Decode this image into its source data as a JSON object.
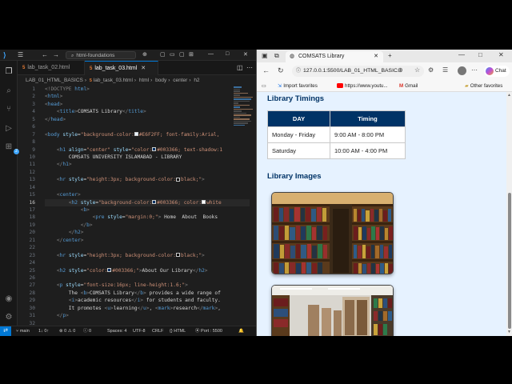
{
  "vscode": {
    "search": "html-foundations",
    "tabs": [
      {
        "label": "lab_task_02.html",
        "active": false
      },
      {
        "label": "lab_task_03.html",
        "active": true
      }
    ],
    "breadcrumb": [
      "LAB_01_HTML_BASICS",
      "lab_task_03.html",
      "html",
      "body",
      "center",
      "h2"
    ],
    "current_line": 16,
    "lines": [
      [
        {
          "c": "p",
          "t": "<!DOCTYPE "
        },
        {
          "c": "t",
          "t": "html"
        },
        {
          "c": "p",
          "t": ">"
        }
      ],
      [
        {
          "c": "p",
          "t": "<"
        },
        {
          "c": "t",
          "t": "html"
        },
        {
          "c": "p",
          "t": ">"
        }
      ],
      [
        {
          "c": "p",
          "t": "<"
        },
        {
          "c": "t",
          "t": "head"
        },
        {
          "c": "p",
          "t": ">"
        }
      ],
      [
        {
          "c": "",
          "t": "    "
        },
        {
          "c": "p",
          "t": "<"
        },
        {
          "c": "t",
          "t": "title"
        },
        {
          "c": "p",
          "t": ">"
        },
        {
          "c": "",
          "t": "COMSATS Library"
        },
        {
          "c": "p",
          "t": "</"
        },
        {
          "c": "t",
          "t": "title"
        },
        {
          "c": "p",
          "t": ">"
        }
      ],
      [
        {
          "c": "p",
          "t": "</"
        },
        {
          "c": "t",
          "t": "head"
        },
        {
          "c": "p",
          "t": ">"
        }
      ],
      [],
      [
        {
          "c": "p",
          "t": "<"
        },
        {
          "c": "t",
          "t": "body "
        },
        {
          "c": "a",
          "t": "style"
        },
        {
          "c": "",
          "t": "="
        },
        {
          "c": "s",
          "t": "\"background-color:"
        },
        {
          "c": "sw",
          "t": "#E6F2FF",
          "col": "#E6F2FF"
        },
        {
          "c": "s",
          "t": "#E6F2FF; font-family:Arial,"
        }
      ],
      [],
      [
        {
          "c": "",
          "t": "    "
        },
        {
          "c": "p",
          "t": "<"
        },
        {
          "c": "t",
          "t": "h1 "
        },
        {
          "c": "a",
          "t": "align"
        },
        {
          "c": "",
          "t": "="
        },
        {
          "c": "s",
          "t": "\"center\" "
        },
        {
          "c": "a",
          "t": "style"
        },
        {
          "c": "",
          "t": "="
        },
        {
          "c": "s",
          "t": "\"color:"
        },
        {
          "c": "sw",
          "t": "#003366",
          "col": "#003366"
        },
        {
          "c": "s",
          "t": "#003366; text-shadow:1"
        }
      ],
      [
        {
          "c": "",
          "t": "        COMSATS UNIVERSITY ISLAMABAD - LIBRARY"
        }
      ],
      [
        {
          "c": "",
          "t": "    "
        },
        {
          "c": "p",
          "t": "</"
        },
        {
          "c": "t",
          "t": "h1"
        },
        {
          "c": "p",
          "t": ">"
        }
      ],
      [],
      [
        {
          "c": "",
          "t": "    "
        },
        {
          "c": "p",
          "t": "<"
        },
        {
          "c": "t",
          "t": "hr "
        },
        {
          "c": "a",
          "t": "style"
        },
        {
          "c": "",
          "t": "="
        },
        {
          "c": "s",
          "t": "\"height:3px; background-color:"
        },
        {
          "c": "sw",
          "t": "black",
          "col": "#000000"
        },
        {
          "c": "s",
          "t": "black;\""
        },
        {
          "c": "p",
          "t": ">"
        }
      ],
      [],
      [
        {
          "c": "",
          "t": "    "
        },
        {
          "c": "p",
          "t": "<"
        },
        {
          "c": "t",
          "t": "center"
        },
        {
          "c": "p",
          "t": ">"
        }
      ],
      [
        {
          "c": "",
          "t": "        "
        },
        {
          "c": "p",
          "t": "<"
        },
        {
          "c": "t",
          "t": "h2 "
        },
        {
          "c": "a",
          "t": "style"
        },
        {
          "c": "",
          "t": "="
        },
        {
          "c": "s",
          "t": "\"background-color:"
        },
        {
          "c": "sw",
          "t": "#003366",
          "col": "#003366"
        },
        {
          "c": "s",
          "t": "#003366; color:"
        },
        {
          "c": "sw",
          "t": "white",
          "col": "#ffffff"
        },
        {
          "c": "s",
          "t": "white"
        }
      ],
      [
        {
          "c": "",
          "t": "            "
        },
        {
          "c": "p",
          "t": "<"
        },
        {
          "c": "t",
          "t": "b"
        },
        {
          "c": "p",
          "t": ">"
        }
      ],
      [
        {
          "c": "",
          "t": "                "
        },
        {
          "c": "p",
          "t": "<"
        },
        {
          "c": "t",
          "t": "pre "
        },
        {
          "c": "a",
          "t": "style"
        },
        {
          "c": "",
          "t": "="
        },
        {
          "c": "s",
          "t": "\"margin:0;\""
        },
        {
          "c": "p",
          "t": ">"
        },
        {
          "c": "",
          "t": " Home  About  Books"
        }
      ],
      [
        {
          "c": "",
          "t": "            "
        },
        {
          "c": "p",
          "t": "</"
        },
        {
          "c": "t",
          "t": "b"
        },
        {
          "c": "p",
          "t": ">"
        }
      ],
      [
        {
          "c": "",
          "t": "        "
        },
        {
          "c": "p",
          "t": "</"
        },
        {
          "c": "t",
          "t": "h2"
        },
        {
          "c": "p",
          "t": ">"
        }
      ],
      [
        {
          "c": "",
          "t": "    "
        },
        {
          "c": "p",
          "t": "</"
        },
        {
          "c": "t",
          "t": "center"
        },
        {
          "c": "p",
          "t": ">"
        }
      ],
      [],
      [
        {
          "c": "",
          "t": "    "
        },
        {
          "c": "p",
          "t": "<"
        },
        {
          "c": "t",
          "t": "hr "
        },
        {
          "c": "a",
          "t": "style"
        },
        {
          "c": "",
          "t": "="
        },
        {
          "c": "s",
          "t": "\"height:3px; background-color:"
        },
        {
          "c": "sw",
          "t": "black",
          "col": "#000000"
        },
        {
          "c": "s",
          "t": "black;\""
        },
        {
          "c": "p",
          "t": ">"
        }
      ],
      [],
      [
        {
          "c": "",
          "t": "    "
        },
        {
          "c": "p",
          "t": "<"
        },
        {
          "c": "t",
          "t": "h2 "
        },
        {
          "c": "a",
          "t": "style"
        },
        {
          "c": "",
          "t": "="
        },
        {
          "c": "s",
          "t": "\"color:"
        },
        {
          "c": "sw",
          "t": "#003366",
          "col": "#003366"
        },
        {
          "c": "s",
          "t": "#003366;\""
        },
        {
          "c": "p",
          "t": ">"
        },
        {
          "c": "",
          "t": "About Our Library"
        },
        {
          "c": "p",
          "t": "</"
        },
        {
          "c": "t",
          "t": "h2"
        },
        {
          "c": "p",
          "t": ">"
        }
      ],
      [],
      [
        {
          "c": "",
          "t": "    "
        },
        {
          "c": "p",
          "t": "<"
        },
        {
          "c": "t",
          "t": "p "
        },
        {
          "c": "a",
          "t": "style"
        },
        {
          "c": "",
          "t": "="
        },
        {
          "c": "s",
          "t": "\"font-size:16px; line-height:1.6;\""
        },
        {
          "c": "p",
          "t": ">"
        }
      ],
      [
        {
          "c": "",
          "t": "        The "
        },
        {
          "c": "p",
          "t": "<"
        },
        {
          "c": "t",
          "t": "b"
        },
        {
          "c": "p",
          "t": ">"
        },
        {
          "c": "",
          "t": "COMSATS Library"
        },
        {
          "c": "p",
          "t": "</"
        },
        {
          "c": "t",
          "t": "b"
        },
        {
          "c": "p",
          "t": ">"
        },
        {
          "c": "",
          "t": " provides a wide range of"
        }
      ],
      [
        {
          "c": "",
          "t": "        "
        },
        {
          "c": "p",
          "t": "<"
        },
        {
          "c": "t",
          "t": "i"
        },
        {
          "c": "p",
          "t": ">"
        },
        {
          "c": "",
          "t": "academic resources"
        },
        {
          "c": "p",
          "t": "</"
        },
        {
          "c": "t",
          "t": "i"
        },
        {
          "c": "p",
          "t": ">"
        },
        {
          "c": "",
          "t": " for students and faculty."
        }
      ],
      [
        {
          "c": "",
          "t": "        It promotes "
        },
        {
          "c": "p",
          "t": "<"
        },
        {
          "c": "t",
          "t": "u"
        },
        {
          "c": "p",
          "t": ">"
        },
        {
          "c": "",
          "t": "learning"
        },
        {
          "c": "p",
          "t": "</"
        },
        {
          "c": "t",
          "t": "u"
        },
        {
          "c": "p",
          "t": ">"
        },
        {
          "c": "",
          "t": ", "
        },
        {
          "c": "p",
          "t": "<"
        },
        {
          "c": "t",
          "t": "mark"
        },
        {
          "c": "p",
          "t": ">"
        },
        {
          "c": "",
          "t": "research"
        },
        {
          "c": "p",
          "t": "</"
        },
        {
          "c": "t",
          "t": "mark"
        },
        {
          "c": "p",
          "t": ">"
        },
        {
          "c": "",
          "t": ","
        }
      ],
      [
        {
          "c": "",
          "t": "    "
        },
        {
          "c": "p",
          "t": "</"
        },
        {
          "c": "t",
          "t": "p"
        },
        {
          "c": "p",
          "t": ">"
        }
      ],
      []
    ],
    "status": {
      "branch": "main",
      "sync": "1↓ 0↑",
      "errors": "0",
      "warnings": "0",
      "info": "0",
      "spaces": "Spaces: 4",
      "encoding": "UTF-8",
      "eol": "CRLF",
      "language": "HTML",
      "port": "Port : 5500"
    }
  },
  "browser": {
    "tab_title": "COMSATS Library",
    "url": "127.0.0.1:5500/LAB_01_HTML_BASIC...",
    "chat_label": "Chat",
    "bookmarks": [
      {
        "label": "Import favorites",
        "icon": "import-icon"
      },
      {
        "label": "https://www.youtu...",
        "icon": "youtube-icon"
      },
      {
        "label": "Gmail",
        "icon": "gmail-icon"
      }
    ],
    "other_favorites": "Other favorites",
    "page": {
      "timings_heading": "Library Timings",
      "table_headers": [
        "DAY",
        "Timing"
      ],
      "table_rows": [
        [
          "Monday - Friday",
          "9:00 AM - 8:00 PM"
        ],
        [
          "Saturday",
          "10:00 AM - 4:00 PM"
        ]
      ],
      "images_heading": "Library Images"
    }
  },
  "colors": {
    "page_bg": "#e6f2ff",
    "heading": "#003366",
    "accent": "#0078d4"
  }
}
